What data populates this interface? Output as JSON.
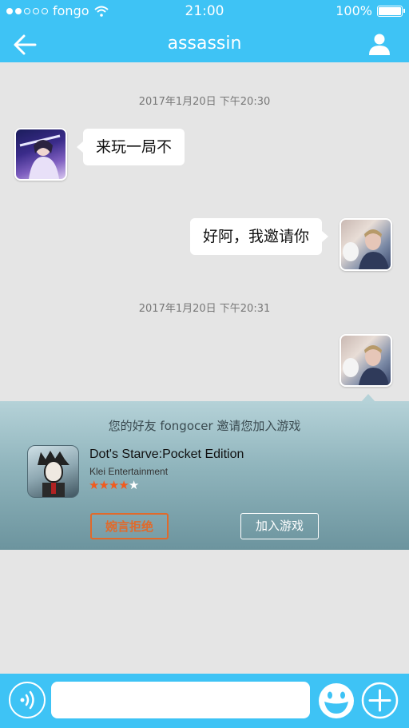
{
  "status_bar": {
    "carrier": "fongo",
    "time": "21:00",
    "battery": "100%",
    "signal_dots_filled": 2,
    "signal_dots_total": 5
  },
  "header": {
    "title": "assassin",
    "back_icon": "arrow-left-icon",
    "profile_icon": "person-icon"
  },
  "messages": [
    {
      "timestamp": "2017年1月20日 下午20:30"
    },
    {
      "sender": "other",
      "text": "来玩一局不"
    },
    {
      "sender": "me",
      "text": "好阿，我邀请你"
    },
    {
      "timestamp": "2017年1月20日 下午20:31"
    }
  ],
  "invite_card": {
    "message": "您的好友 fongocer 邀请您加入游戏",
    "game_title": "Dot's Starve:Pocket Edition",
    "developer": "Klei Entertainment",
    "rating": 4,
    "rating_max": 5,
    "decline_label": "婉言拒绝",
    "join_label": "加入游戏"
  },
  "input_bar": {
    "voice_icon": "voice-icon",
    "emoji_icon": "emoji-icon",
    "plus_icon": "plus-icon",
    "placeholder": ""
  },
  "colors": {
    "brand": "#3ec3f5",
    "background": "#e5e5e5",
    "decline": "#e06a2b",
    "star": "#f25a1d"
  }
}
